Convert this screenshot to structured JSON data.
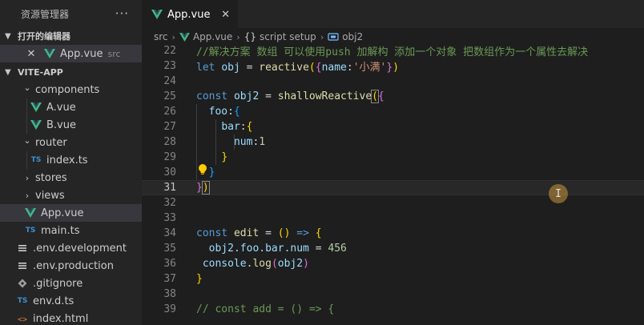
{
  "sidebar": {
    "title": "资源管理器",
    "more": "···",
    "open_editors": {
      "title": "打开的编辑器",
      "items": [
        {
          "name": "App.vue",
          "desc": "src"
        }
      ]
    },
    "project": {
      "title": "VITE-APP",
      "items": [
        {
          "label": "components",
          "kind": "folder-open",
          "depth": 1
        },
        {
          "label": "A.vue",
          "kind": "vue",
          "depth": 2
        },
        {
          "label": "B.vue",
          "kind": "vue",
          "depth": 2
        },
        {
          "label": "router",
          "kind": "folder-open",
          "depth": 1
        },
        {
          "label": "index.ts",
          "kind": "ts",
          "depth": 2
        },
        {
          "label": "stores",
          "kind": "folder",
          "depth": 1
        },
        {
          "label": "views",
          "kind": "folder",
          "depth": 1
        },
        {
          "label": "App.vue",
          "kind": "vue",
          "depth": 1,
          "active": true
        },
        {
          "label": "main.ts",
          "kind": "ts",
          "depth": 1
        },
        {
          "label": ".env.development",
          "kind": "env",
          "depth": 0
        },
        {
          "label": ".env.production",
          "kind": "env",
          "depth": 0
        },
        {
          "label": ".gitignore",
          "kind": "git",
          "depth": 0
        },
        {
          "label": "env.d.ts",
          "kind": "ts",
          "depth": 0
        },
        {
          "label": "index.html",
          "kind": "html",
          "depth": 0
        }
      ]
    }
  },
  "editor": {
    "tab": {
      "label": "App.vue",
      "close": "✕"
    },
    "breadcrumb": {
      "src": "src",
      "file": "App.vue",
      "section_icon": "{}",
      "section": "script setup",
      "symbol": "obj2"
    },
    "lines": [
      "22",
      "23",
      "24",
      "25",
      "26",
      "27",
      "28",
      "29",
      "30",
      "31",
      "32",
      "33",
      "34",
      "35",
      "36",
      "37",
      "38",
      "39"
    ],
    "current_line": "31",
    "code": {
      "comment1": "//解决方案 数组 可以使用push 加解构 添加一个对象 把数组作为一个属性去解决",
      "let": "let",
      "obj": "obj",
      "reactive": "reactive",
      "name_key": "name",
      "name_val": "'小满'",
      "const": "const",
      "obj2": "obj2",
      "shallowReactive": "shallowReactive",
      "foo": "foo",
      "bar": "bar",
      "num": "num",
      "num_val": "1",
      "edit": "edit",
      "obj2_chain": "obj2.foo.bar.num",
      "num_val2": "456",
      "console": "console",
      "log": "log",
      "comment2": "// const add = () => {"
    }
  },
  "colors": {
    "accent_vue": "#41b883",
    "ts": "#3d8fd1"
  }
}
